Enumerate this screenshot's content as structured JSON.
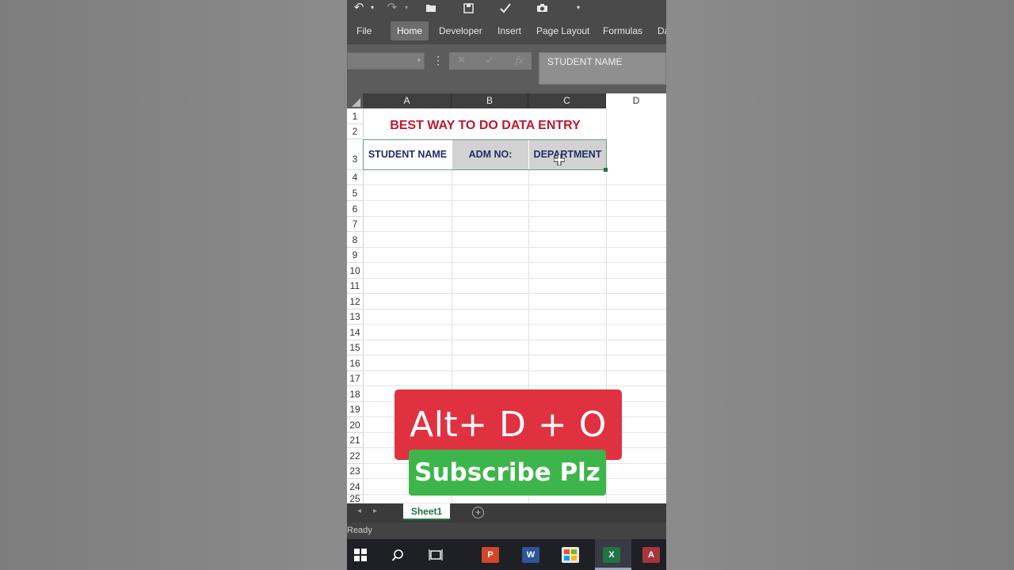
{
  "ribbon": {
    "tabs": [
      {
        "label": "File"
      },
      {
        "label": "Home"
      },
      {
        "label": "Developer"
      },
      {
        "label": "Insert"
      },
      {
        "label": "Page Layout"
      },
      {
        "label": "Formulas"
      },
      {
        "label": "Da"
      }
    ],
    "active_tab": "Home"
  },
  "formula_bar": {
    "fx_label": "fx",
    "value": "STUDENT NAME"
  },
  "sheet": {
    "columns": [
      "A",
      "B",
      "C",
      "D"
    ],
    "rows": [
      "1",
      "2",
      "3",
      "4",
      "5",
      "6",
      "7",
      "8",
      "9",
      "10",
      "11",
      "12",
      "13",
      "14",
      "15",
      "16",
      "17",
      "18",
      "19",
      "20",
      "21",
      "22",
      "23",
      "24",
      "25"
    ],
    "title": "BEST WAY TO DO DATA ENTRY",
    "headers": [
      "STUDENT NAME",
      "ADM NO:",
      "DEPARTMENT"
    ]
  },
  "sheet_tabs": {
    "active": "Sheet1"
  },
  "status": {
    "text": "Ready"
  },
  "overlay": {
    "shortcut": "Alt+ D + O",
    "subscribe": "Subscribe Plz"
  },
  "colors": {
    "title_red": "#c0182f",
    "header_navy": "#1f2f63",
    "excel_green": "#217346",
    "overlay_red": "#e03140",
    "overlay_green": "#3db54a"
  }
}
